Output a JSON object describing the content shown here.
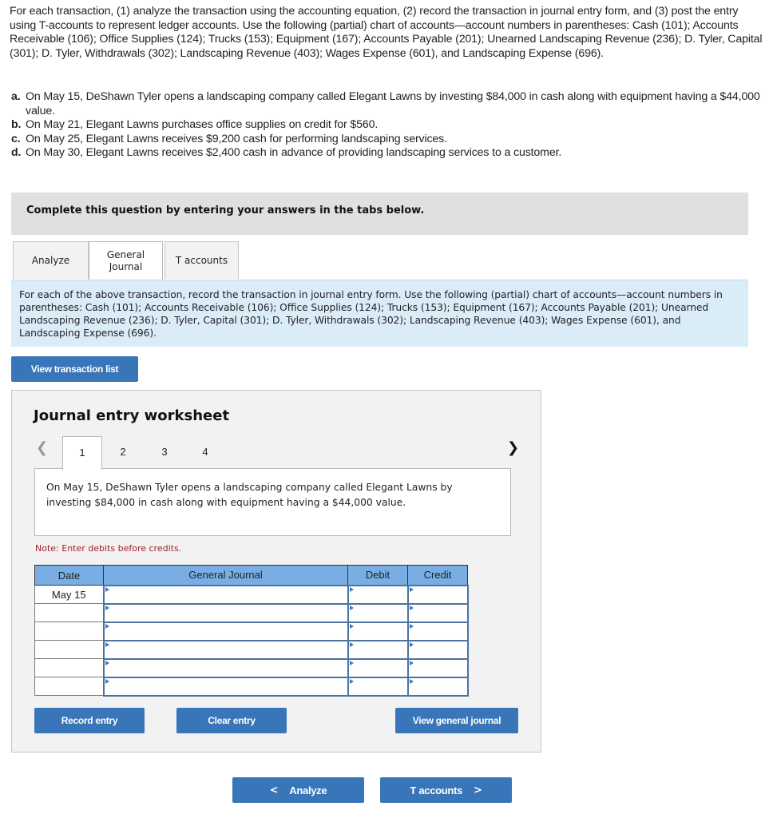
{
  "intro": "For each transaction, (1) analyze the transaction using the accounting equation, (2) record the transaction in journal entry form, and (3) post the entry using T-accounts to represent ledger accounts. Use the following (partial) chart of accounts—account numbers in parentheses: Cash (101); Accounts Receivable (106); Office Supplies (124); Trucks (153); Equipment (167); Accounts Payable (201); Unearned Landscaping Revenue (236); D. Tyler, Capital (301); D. Tyler, Withdrawals (302); Landscaping Revenue (403); Wages Expense (601), and Landscaping Expense (696).",
  "transactions": [
    {
      "letter": "a.",
      "text": "On May 15, DeShawn Tyler opens a landscaping company called Elegant Lawns by investing $84,000 in cash along with equipment having a $44,000 value."
    },
    {
      "letter": "b.",
      "text": "On May 21, Elegant Lawns purchases office supplies on credit for $560."
    },
    {
      "letter": "c.",
      "text": "On May 25, Elegant Lawns receives $9,200 cash for performing landscaping services."
    },
    {
      "letter": "d.",
      "text": "On May 30, Elegant Lawns receives $2,400 cash in advance of providing landscaping services to a customer."
    }
  ],
  "banner": "Complete this question by entering your answers in the tabs below.",
  "tabs": [
    {
      "label": "Analyze",
      "active": false
    },
    {
      "label": "General Journal",
      "line1": "General",
      "line2": "Journal",
      "active": true
    },
    {
      "label": "T accounts",
      "active": false
    }
  ],
  "instructions": "For each of the above transaction, record the transaction in journal entry form. Use the following (partial) chart of accounts—account numbers in parentheses: Cash (101); Accounts Receivable (106); Office Supplies (124); Trucks (153); Equipment (167); Accounts Payable (201); Unearned Landscaping Revenue (236); D. Tyler, Capital (301); D. Tyler, Withdrawals (302); Landscaping Revenue (403); Wages Expense (601), and Landscaping Expense (696).",
  "view_transaction_list": "View transaction list",
  "worksheet": {
    "title": "Journal entry worksheet",
    "prev_icon": "chevron-left-icon",
    "next_icon": "chevron-right-icon",
    "steps": [
      "1",
      "2",
      "3",
      "4"
    ],
    "active_step": "1",
    "description": "On May 15, DeShawn Tyler opens a landscaping company called Elegant Lawns by investing $84,000 in cash along with equipment having a $44,000 value.",
    "note": "Note: Enter debits before credits.",
    "table": {
      "headers": {
        "date": "Date",
        "account": "General Journal",
        "debit": "Debit",
        "credit": "Credit"
      },
      "rows": [
        {
          "date": "May 15",
          "account": "",
          "debit": "",
          "credit": ""
        },
        {
          "date": "",
          "account": "",
          "debit": "",
          "credit": ""
        },
        {
          "date": "",
          "account": "",
          "debit": "",
          "credit": ""
        },
        {
          "date": "",
          "account": "",
          "debit": "",
          "credit": ""
        },
        {
          "date": "",
          "account": "",
          "debit": "",
          "credit": ""
        },
        {
          "date": "",
          "account": "",
          "debit": "",
          "credit": ""
        }
      ]
    },
    "buttons": {
      "record": "Record entry",
      "clear": "Clear entry",
      "view_gj": "View general journal"
    }
  },
  "nav": {
    "prev_label": "Analyze",
    "next_label": "T accounts",
    "prev_chevron": "<",
    "next_chevron": ">"
  },
  "colors": {
    "button": "#3975b9",
    "table_header": "#78aee4",
    "instructions_bg": "#dbecf9",
    "note": "#a3202a",
    "banner_bg": "#e0e0e0"
  }
}
